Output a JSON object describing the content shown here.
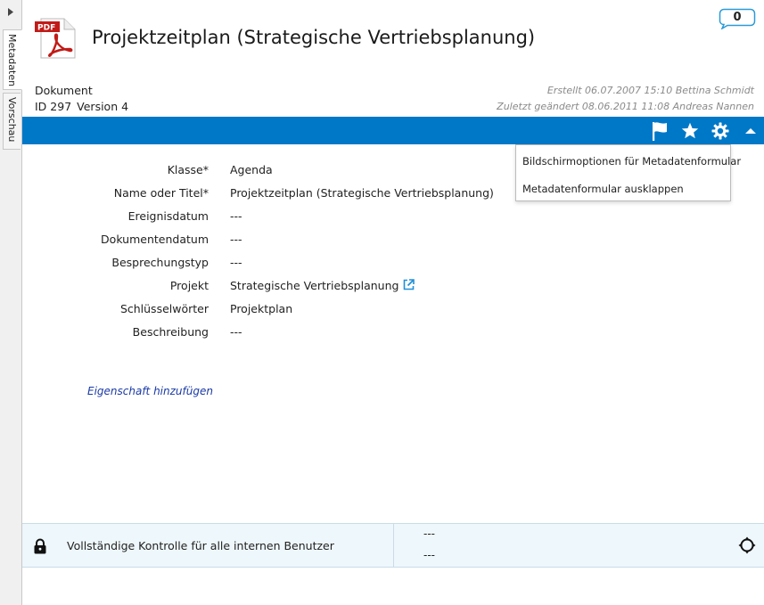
{
  "side_tabs": [
    {
      "label": "Metadaten"
    },
    {
      "label": "Vorschau"
    }
  ],
  "header": {
    "file_type_badge": "PDF",
    "title": "Projektzeitplan (Strategische Vertriebsplanung)",
    "comment_count": "0",
    "doc_type": "Dokument",
    "id_label": "ID 297",
    "version_label": "Version 4",
    "created": "Erstellt 06.07.2007 15:10 Bettina Schmidt",
    "changed": "Zuletzt geändert 08.06.2011 11:08 Andreas Nannen"
  },
  "toolbar": {
    "icons": [
      "flag-icon",
      "star-icon",
      "gear-icon",
      "collapse-up-icon"
    ],
    "color": "#0078c8"
  },
  "dropdown": {
    "items": [
      {
        "label": "Bildschirmoptionen für Metadatenformular"
      },
      {
        "label": "Metadatenformular ausklappen"
      }
    ]
  },
  "form": {
    "rows": [
      {
        "label": "Klasse*",
        "value": "Agenda"
      },
      {
        "label": "Name oder Titel*",
        "value": "Projektzeitplan (Strategische Vertriebsplanung)"
      },
      {
        "label": "Ereignisdatum",
        "value": "---"
      },
      {
        "label": "Dokumentendatum",
        "value": "---"
      },
      {
        "label": "Besprechungstyp",
        "value": "---"
      },
      {
        "label": "Projekt",
        "value": "Strategische Vertriebsplanung"
      },
      {
        "label": "Schlüsselwörter",
        "value": "Projektplan"
      },
      {
        "label": "Beschreibung",
        "value": "---"
      }
    ],
    "add_property": "Eigenschaft hinzufügen"
  },
  "permissions": {
    "text": "Vollständige Kontrolle für alle internen Benutzer",
    "value1": "---",
    "value2": "---"
  }
}
